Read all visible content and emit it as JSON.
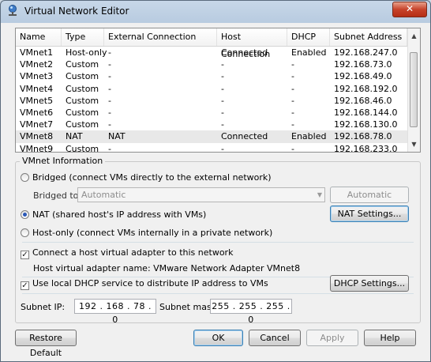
{
  "window": {
    "title": "Virtual Network Editor",
    "close_glyph": "✕"
  },
  "table": {
    "columns": [
      "Name",
      "Type",
      "External Connection",
      "Host Connection",
      "DHCP",
      "Subnet Address"
    ],
    "rows": [
      [
        "VMnet1",
        "Host-only",
        "-",
        "Connected",
        "Enabled",
        "192.168.247.0"
      ],
      [
        "VMnet2",
        "Custom",
        "-",
        "-",
        "-",
        "192.168.73.0"
      ],
      [
        "VMnet3",
        "Custom",
        "-",
        "-",
        "-",
        "192.168.49.0"
      ],
      [
        "VMnet4",
        "Custom",
        "-",
        "-",
        "-",
        "192.168.192.0"
      ],
      [
        "VMnet5",
        "Custom",
        "-",
        "-",
        "-",
        "192.168.46.0"
      ],
      [
        "VMnet6",
        "Custom",
        "-",
        "-",
        "-",
        "192.168.144.0"
      ],
      [
        "VMnet7",
        "Custom",
        "-",
        "-",
        "-",
        "192.168.130.0"
      ],
      [
        "VMnet8",
        "NAT",
        "NAT",
        "Connected",
        "Enabled",
        "192.168.78.0"
      ],
      [
        "VMnet9",
        "Custom",
        "-",
        "-",
        "-",
        "192.168.233.0"
      ]
    ],
    "selected_row": 7
  },
  "info": {
    "group_label": "VMnet Information",
    "bridged_label": "Bridged (connect VMs directly to the external network)",
    "bridged_to_label": "Bridged to:",
    "bridged_to_value": "Automatic",
    "auto_settings_button": "Automatic Settings...",
    "nat_label": "NAT (shared host's IP address with VMs)",
    "nat_settings_button": "NAT Settings...",
    "hostonly_label": "Host-only (connect VMs internally in a private network)",
    "connect_adapter_label": "Connect a host virtual adapter to this network",
    "adapter_name_text": "Host virtual adapter name: VMware Network Adapter VMnet8",
    "dhcp_label": "Use local DHCP service to distribute IP address to VMs",
    "dhcp_settings_button": "DHCP Settings...",
    "subnet_ip_label": "Subnet IP:",
    "subnet_ip": "192 . 168 . 78  .  0",
    "subnet_mask_label": "Subnet mask:",
    "subnet_mask": "255 . 255 . 255 .  0",
    "selected_mode": "NAT",
    "connect_adapter_checked": true,
    "dhcp_checked": true
  },
  "footer": {
    "restore_default": "Restore Default",
    "ok": "OK",
    "cancel": "Cancel",
    "apply": "Apply",
    "help": "Help"
  },
  "colors": {
    "selected_row": "#e8e8e8",
    "radio_dot": "#2a58b7",
    "close_button": "#c7432a"
  }
}
